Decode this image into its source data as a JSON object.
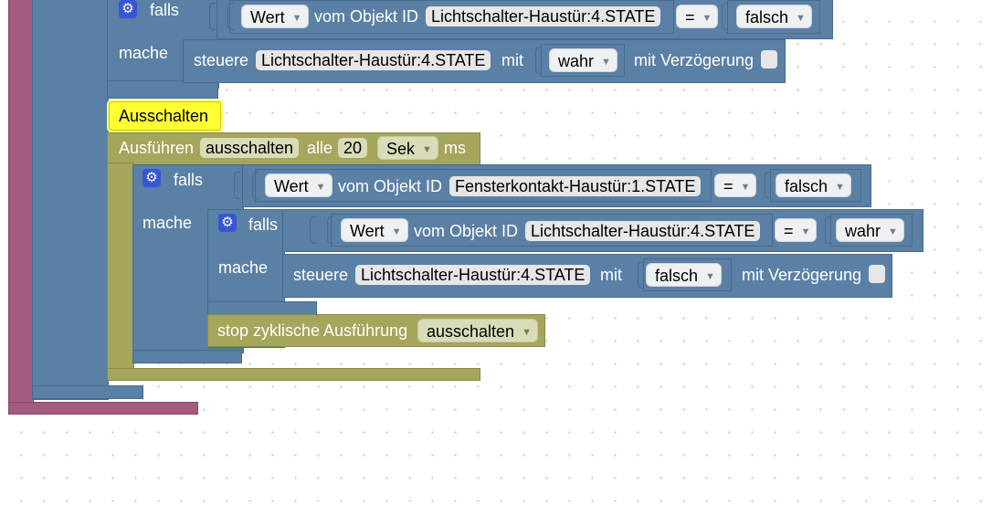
{
  "workspace": {
    "outer_if": {
      "falls_label": "falls",
      "mache_label": "mache",
      "condition": {
        "value_dropdown": "Wert",
        "object_label": "vom Objekt ID",
        "object_id": "Lichtschalter-Haustür:4.STATE",
        "operator": "=",
        "compare_value": "falsch"
      },
      "action": {
        "steuere_label": "steuere",
        "object_id": "Lichtschalter-Haustür:4.STATE",
        "mit_label": "mit",
        "value": "wahr",
        "delay_label": "mit Verzögerung"
      }
    },
    "comment_block": {
      "text": "Ausschalten"
    },
    "interval_block": {
      "run_label": "Ausführen",
      "name": "ausschalten",
      "every_label": "alle",
      "interval_value": "20",
      "unit": "Sek",
      "ms_label": "ms"
    },
    "if_window": {
      "falls_label": "falls",
      "mache_label": "mache",
      "condition": {
        "value_dropdown": "Wert",
        "object_label": "vom Objekt ID",
        "object_id": "Fensterkontakt-Haustür:1.STATE",
        "operator": "=",
        "compare_value": "falsch"
      }
    },
    "if_light": {
      "falls_label": "falls",
      "mache_label": "mache",
      "condition": {
        "value_dropdown": "Wert",
        "object_label": "vom Objekt ID",
        "object_id": "Lichtschalter-Haustür:4.STATE",
        "operator": "=",
        "compare_value": "wahr"
      },
      "action": {
        "steuere_label": "steuere",
        "object_id": "Lichtschalter-Haustür:4.STATE",
        "mit_label": "mit",
        "value": "falsch",
        "delay_label": "mit Verzögerung"
      }
    },
    "stop_block": {
      "label": "stop zyklische Ausführung",
      "target": "ausschalten"
    }
  },
  "colors": {
    "logic_blue": "#5b80a5",
    "event_magenta": "#a55b80",
    "timer_olive": "#a5a55c",
    "comment_yellow": "#ffff33"
  },
  "icons": {
    "mutator": "gear-icon",
    "dropdown": "chevron-down-icon"
  }
}
